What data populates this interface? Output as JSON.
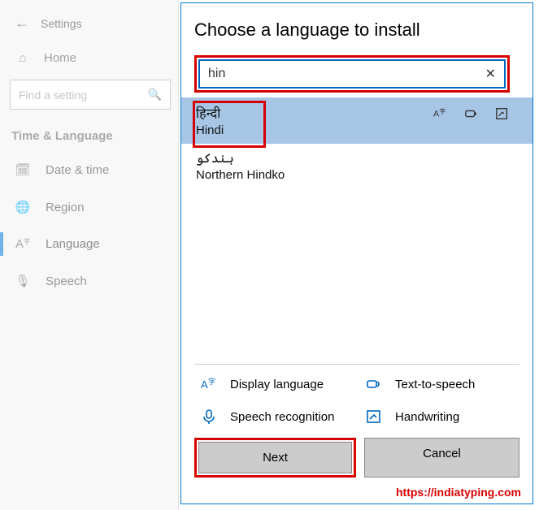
{
  "sidebar": {
    "title": "Settings",
    "home_label": "Home",
    "search_placeholder": "Find a setting",
    "section_heading": "Time & Language",
    "items": [
      {
        "label": "Date & time"
      },
      {
        "label": "Region"
      },
      {
        "label": "Language"
      },
      {
        "label": "Speech"
      }
    ]
  },
  "dialog": {
    "title": "Choose a language to install",
    "search_value": "hin",
    "results": [
      {
        "native": "हिन्दी",
        "english": "Hindi"
      },
      {
        "native": "ہندکو",
        "english": "Northern Hindko"
      }
    ],
    "features": {
      "display": "Display language",
      "tts": "Text-to-speech",
      "speech": "Speech recognition",
      "handwriting": "Handwriting"
    },
    "buttons": {
      "next": "Next",
      "cancel": "Cancel"
    }
  },
  "watermark": "https://indiatyping.com"
}
